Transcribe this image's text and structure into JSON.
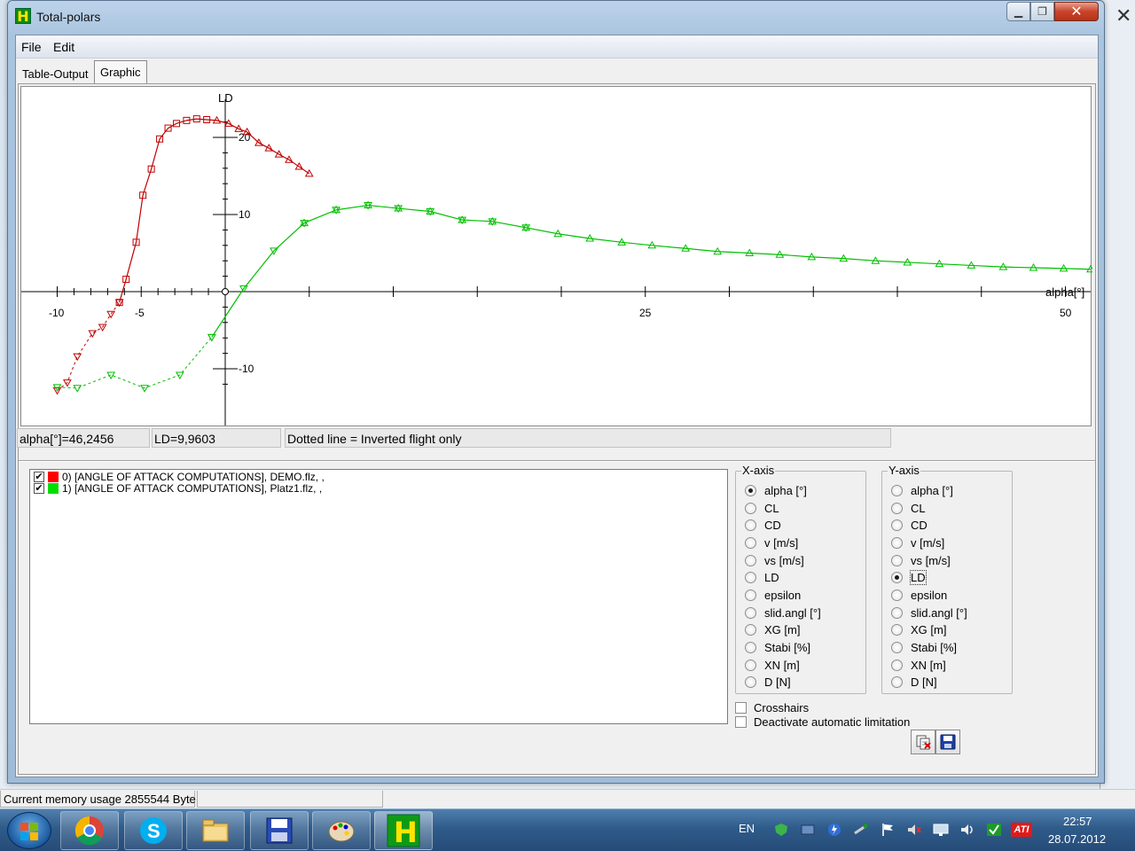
{
  "window": {
    "title": "Total-polars",
    "close_glyph": "✕",
    "min_glyph": "▁",
    "max_glyph": "❐"
  },
  "menu": {
    "file": "File",
    "edit": "Edit"
  },
  "tabs": {
    "table_output": "Table-Output",
    "graphic": "Graphic"
  },
  "graph": {
    "y_axis_label": "LD",
    "x_axis_label": "alpha[°]",
    "x_ticks": [
      "-10",
      "-5",
      "25",
      "50"
    ],
    "y_ticks": [
      "20",
      "10",
      "-10"
    ]
  },
  "readout": {
    "cursor_x": "alpha[°]=46,2456",
    "cursor_y": "LD=9,9603",
    "note": "Dotted line = Inverted flight only"
  },
  "series_list": [
    {
      "label": "0) [ANGLE OF ATTACK COMPUTATIONS], DEMO.flz, ,",
      "checked": true,
      "color": "#ff0000"
    },
    {
      "label": "1) [ANGLE OF ATTACK COMPUTATIONS], Platz1.flz, ,",
      "checked": true,
      "color": "#00cc00"
    }
  ],
  "x_axis_group": {
    "legend": "X-axis",
    "options": [
      "alpha [°]",
      "CL",
      "CD",
      "v [m/s]",
      "vs [m/s]",
      "LD",
      "epsilon",
      "slid.angl [°]",
      "XG [m]",
      "Stabi [%]",
      "XN [m]",
      "D [N]"
    ],
    "selected": "alpha [°]"
  },
  "y_axis_group": {
    "legend": "Y-axis",
    "options": [
      "alpha [°]",
      "CL",
      "CD",
      "v [m/s]",
      "vs [m/s]",
      "LD",
      "epsilon",
      "slid.angl [°]",
      "XG [m]",
      "Stabi [%]",
      "XN [m]",
      "D [N]"
    ],
    "selected": "LD"
  },
  "options": {
    "crosshairs": "Crosshairs",
    "deactivate_limitation": "Deactivate automatic limitation"
  },
  "status": {
    "memory": "Current memory usage 2855544 Byte"
  },
  "taskbar": {
    "language": "EN",
    "time": "22:57",
    "date": "28.07.2012",
    "ati_label": "ATI"
  },
  "chart_data": {
    "type": "line",
    "xlabel": "alpha[°]",
    "ylabel": "LD",
    "xlim": [
      -10,
      50
    ],
    "ylim": [
      -12,
      22
    ],
    "series": [
      {
        "name": "0) [ANGLE OF ATTACK COMPUTATIONS], DEMO.flz, ,",
        "color": "#c00000",
        "inverted": {
          "x": [
            -10,
            -9.4,
            -8.8,
            -7.9,
            -7.3,
            -6.8,
            -6.3
          ],
          "y": [
            -12.8,
            -11.8,
            -8.4,
            -5.4,
            -4.6,
            -2.9,
            -1.4
          ]
        },
        "normal": {
          "x": [
            -6.3,
            -5.9,
            -5.3,
            -4.9,
            -4.4,
            -3.9,
            -3.4,
            -2.9,
            -2.3,
            -1.7,
            -1.1,
            -0.5,
            0.2,
            0.8,
            1.3,
            2.0,
            2.6,
            3.2,
            3.8,
            4.4,
            5.0
          ],
          "y": [
            -1.4,
            1.6,
            6.4,
            12.5,
            15.9,
            19.8,
            21.2,
            21.8,
            22.2,
            22.4,
            22.3,
            22.2,
            21.8,
            21.1,
            20.7,
            19.3,
            18.6,
            17.8,
            17.1,
            16.2,
            15.3
          ]
        }
      },
      {
        "name": "1) [ANGLE OF ATTACK COMPUTATIONS], Platz1.flz, ,",
        "color": "#00c000",
        "inverted": {
          "x": [
            -10,
            -8.8,
            -6.8,
            -4.8,
            -2.7,
            -0.8
          ],
          "y": [
            -12.4,
            -12.5,
            -10.8,
            -12.5,
            -10.8,
            -5.9
          ]
        },
        "normal": {
          "x": [
            -0.8,
            1.1,
            2.9,
            4.7,
            6.6,
            8.5,
            10.3,
            12.2,
            14.1,
            15.9,
            17.9,
            19.8,
            21.7,
            23.6,
            25.4,
            27.4,
            29.3,
            31.2,
            33.0,
            34.9,
            36.8,
            38.7,
            40.6,
            42.5,
            44.4,
            46.3,
            48.1,
            49.9,
            51.5
          ],
          "y": [
            -5.9,
            0.4,
            5.3,
            8.9,
            10.6,
            11.2,
            10.8,
            10.4,
            9.3,
            9.1,
            8.3,
            7.5,
            6.9,
            6.4,
            6.0,
            5.6,
            5.2,
            5.0,
            4.8,
            4.5,
            4.3,
            4.0,
            3.8,
            3.6,
            3.4,
            3.2,
            3.1,
            3.0,
            2.9
          ]
        }
      }
    ]
  }
}
